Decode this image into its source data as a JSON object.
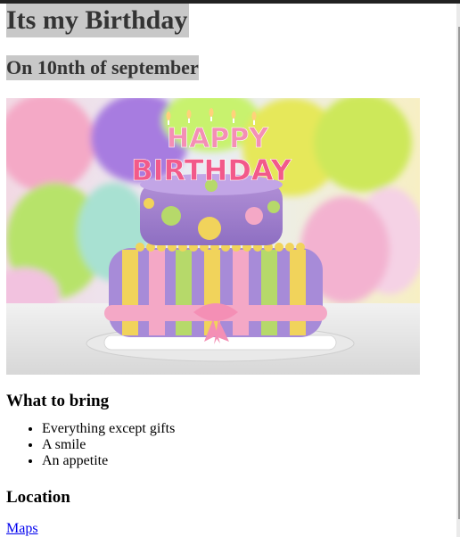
{
  "page": {
    "title": "Its my Birthday",
    "subtitle": "On 10nth of september"
  },
  "image": {
    "cake_text_line1": "HAPPY",
    "cake_text_line2": "BIRTHDAY"
  },
  "bring": {
    "heading": "What to bring",
    "items": [
      "Everything except gifts",
      "A smile",
      "An appetite"
    ]
  },
  "location": {
    "heading": "Location",
    "link_label": "Maps"
  },
  "colors": {
    "heading_bg": "#c8c8c8",
    "link": "#0000ee"
  }
}
